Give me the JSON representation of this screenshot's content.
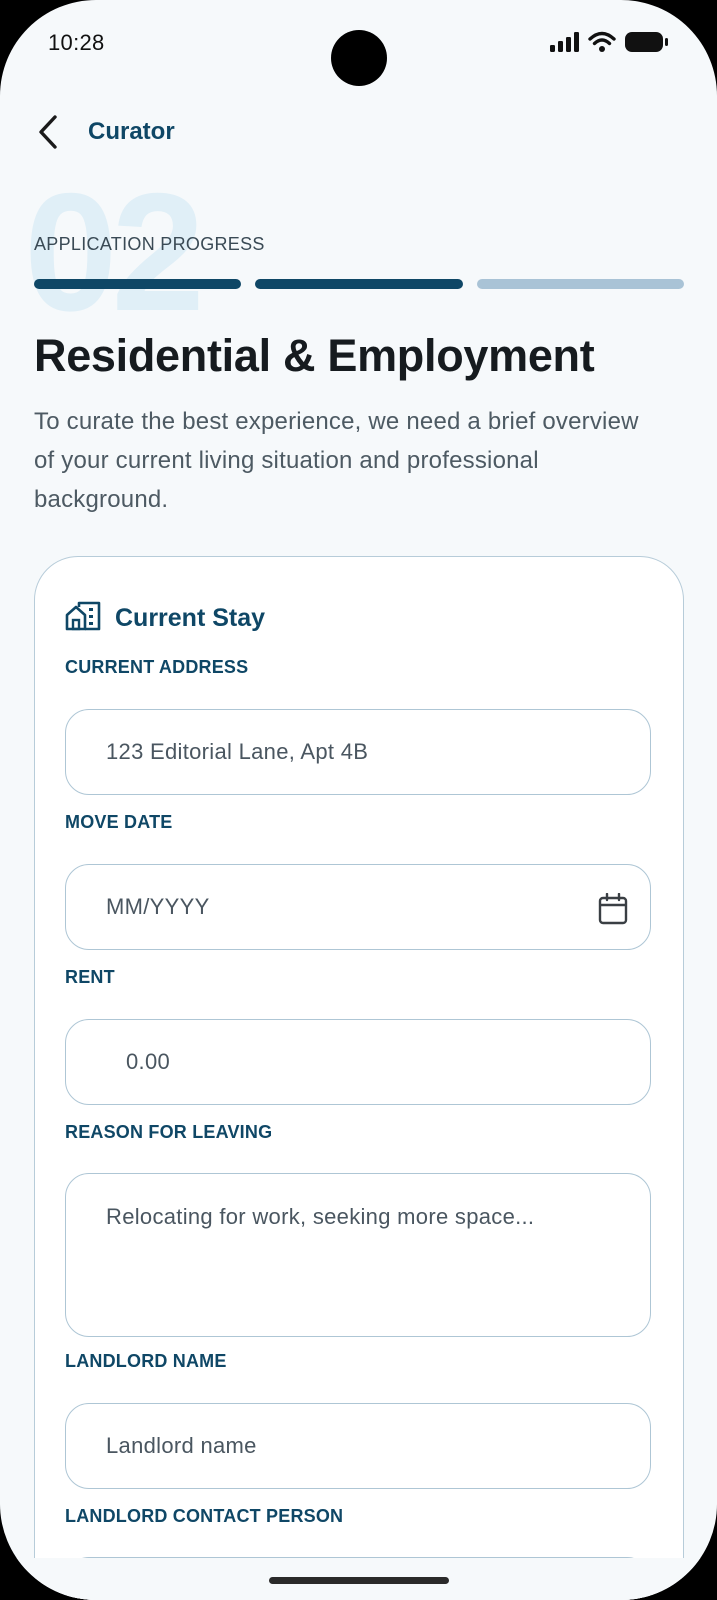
{
  "status_bar": {
    "time": "10:28",
    "icons": [
      "signal-icon",
      "wifi-icon",
      "battery-icon"
    ]
  },
  "header": {
    "back_icon": "chevron-left-icon",
    "title": "Curator"
  },
  "progress": {
    "step_number": "02",
    "label": "APPLICATION PROGRESS",
    "total_steps": 3,
    "completed_steps": 2
  },
  "page": {
    "title": "Residential & Employment",
    "description": "To curate the best experience, we need a brief overview of your current living situation and professional background."
  },
  "current_stay": {
    "heading": "Current Stay",
    "heading_icon": "building-icon",
    "fields": {
      "address": {
        "label": "CURRENT ADDRESS",
        "placeholder": "123 Editorial Lane, Apt 4B"
      },
      "move_date": {
        "label": "MOVE DATE",
        "placeholder": "MM/YYYY",
        "icon": "calendar-icon"
      },
      "rent": {
        "label": "RENT",
        "placeholder": "0.00"
      },
      "reason": {
        "label": "REASON FOR LEAVING",
        "placeholder": "Relocating for work, seeking more space..."
      },
      "landlord_name": {
        "label": "LANDLORD NAME",
        "placeholder": "Landlord name"
      },
      "landlord_contact": {
        "label": "LANDLORD CONTACT PERSON"
      }
    }
  },
  "colors": {
    "brand": "#0f4766",
    "progress_inactive": "#a9c3d6",
    "background": "#f6f9fb",
    "border": "#aec6d5"
  }
}
